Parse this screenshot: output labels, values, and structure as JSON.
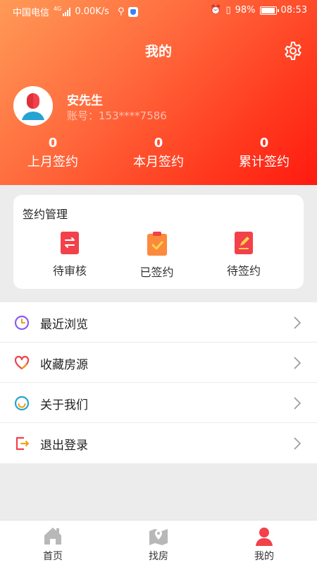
{
  "status_bar": {
    "carrier": "中国电信",
    "network": "4G",
    "speed": "0.00K/s",
    "battery": "98%",
    "time": "08:53"
  },
  "header": {
    "title": "我的",
    "settings_icon": "gear-icon"
  },
  "profile": {
    "name": "安先生",
    "account_label": "账号：",
    "account_value": "153****7586"
  },
  "stats": [
    {
      "value": "0",
      "label": "上月签约"
    },
    {
      "value": "0",
      "label": "本月签约"
    },
    {
      "value": "0",
      "label": "累计签约"
    }
  ],
  "sign_management": {
    "title": "签约管理",
    "items": [
      {
        "label": "待审核",
        "icon": "exchange-doc-icon",
        "color": "#f2414a"
      },
      {
        "label": "已签约",
        "icon": "clipboard-check-icon",
        "color": "#fb8a3c"
      },
      {
        "label": "待签约",
        "icon": "edit-doc-icon",
        "color": "#f2414a"
      }
    ]
  },
  "menu": [
    {
      "label": "最近浏览",
      "icon": "clock-icon"
    },
    {
      "label": "收藏房源",
      "icon": "heart-icon"
    },
    {
      "label": "关于我们",
      "icon": "smile-icon"
    },
    {
      "label": "退出登录",
      "icon": "logout-icon"
    }
  ],
  "tabbar": [
    {
      "label": "首页",
      "icon": "home-icon",
      "active": false
    },
    {
      "label": "找房",
      "icon": "map-pin-icon",
      "active": false
    },
    {
      "label": "我的",
      "icon": "user-icon",
      "active": true
    }
  ],
  "colors": {
    "header_gradient_start": "#ff9a56",
    "header_gradient_end": "#ff1a10",
    "accent_red": "#f2414a",
    "accent_orange": "#fb8a3c"
  }
}
